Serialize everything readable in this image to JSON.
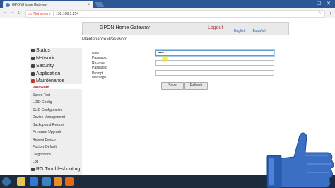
{
  "browser": {
    "tab_title": "GPON Home Gateway",
    "tab_close": "×",
    "security_label": "Not secure",
    "url": "192.168.1.254",
    "window_controls": [
      "—",
      "☐",
      "✕"
    ]
  },
  "header": {
    "brand": "GPON Home Gateway",
    "logout": "Logout",
    "lang_en": "English",
    "lang_es": "Español"
  },
  "breadcrumb": "Maintenance>Password",
  "nav": {
    "sections": [
      "Status",
      "Network",
      "Security",
      "Application",
      "Maintenance"
    ],
    "sub_items": [
      "Password",
      "Speed Test",
      "LOID Config",
      "SLID Configuration",
      "Device Management",
      "Backup and Restore",
      "Firmware Upgrade",
      "Reboot Device",
      "Factory Default",
      "Diagnostics",
      "Log"
    ],
    "footer_section": "RG Troubleshooting"
  },
  "form": {
    "new_password_label": "New Password",
    "new_password_value": "•••••",
    "reenter_label": "Re-enter Password",
    "prompt_label": "Prompt Message",
    "save": "Save",
    "refresh": "Refresh"
  },
  "icons": {
    "back": "back-arrow-icon",
    "forward": "forward-arrow-icon",
    "reload": "reload-icon",
    "warning": "warning-icon",
    "bookmark": "star-icon",
    "menu": "menu-dots-icon",
    "overlay": "thumbs-up-icon"
  },
  "colors": {
    "tab_strip": "#2b5797",
    "active_section": "#c0392b",
    "link": "#2f5fa7",
    "taskbar": "#1d2b3d",
    "thumb": "#3b6fc4"
  }
}
